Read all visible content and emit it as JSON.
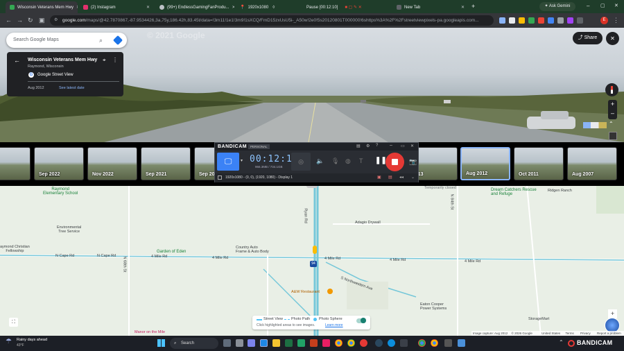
{
  "tabs": [
    {
      "title": "Wisconsin Veterans Mem Hwy",
      "color": "#34a853",
      "active": true
    },
    {
      "title": "(2) Instagram",
      "color": "#e1306c",
      "active": false
    },
    {
      "title": "(99+) EndlessGamingFanProdu...",
      "color": "#bdc1c6",
      "active": false
    },
    {
      "title": "1920x1080",
      "color": "#bdc1c6",
      "active": false
    },
    {
      "title": "Pause [00:12:10]",
      "color": "#bdc1c6",
      "active": false
    },
    {
      "title": "New Tab",
      "color": "#bdc1c6",
      "active": false
    }
  ],
  "browser": {
    "ask_gemini": "Ask Gemini",
    "url_host": "google.com",
    "url_path": "/maps/@42.7870867,-87.9534426,3a,75y,186.42h,83.45t/data=!3m11!1e1!3m9!1sXCQ/FmD15zxUsU5i-_A50w!2e0!5s20120801T000000!6shttps%3A%2F%2Fstreetviewpixels-pa.googleapis.com...",
    "profile_letter": "E"
  },
  "maps": {
    "search_placeholder": "Search Google Maps",
    "share_label": "Share",
    "watermark": "© 2021 Google",
    "place_title": "Wisconsin Veterans Mem Hwy",
    "place_subtitle": "Raymond, Wisconsin",
    "source_label": "Google Street View",
    "capture_date": "Aug 2012",
    "see_latest": "See latest date"
  },
  "filmstrip": [
    {
      "label": "",
      "selected": false
    },
    {
      "label": "Sep 2022",
      "selected": false
    },
    {
      "label": "Nov 2022",
      "selected": false
    },
    {
      "label": "Sep 2021",
      "selected": false
    },
    {
      "label": "Sep 20",
      "selected": false
    },
    {
      "label": "2013",
      "selected": false
    },
    {
      "label": "Aug 2012",
      "selected": true
    },
    {
      "label": "Oct 2011",
      "selected": false
    },
    {
      "label": "Aug 2007",
      "selected": false
    }
  ],
  "bandicam": {
    "brand": "BANDICAM",
    "edition": "PERSONAL",
    "timer": "00:12:10",
    "filesize": "966.3MB / 734.1GB",
    "resolution_info": "1920x1080 - (0, 0), (1920, 1080) - Display 1"
  },
  "map_labels": {
    "places": [
      {
        "text": "Raymond\nElementary School",
        "kind": "green"
      },
      {
        "text": "Environmental\nTree Service",
        "kind": "dark"
      },
      {
        "text": "aymond Christian\nFellowship",
        "kind": "dark"
      },
      {
        "text": "Garden of Eden",
        "kind": "green"
      },
      {
        "text": "Country Auto\nFrame & Auto Body",
        "kind": "dark"
      },
      {
        "text": "Adagio Drywall",
        "kind": "dark"
      },
      {
        "text": "A&W Restaurant",
        "kind": "orange"
      },
      {
        "text": "Eaton Cooper\nPower Systems",
        "kind": "dark"
      },
      {
        "text": "StorageMart",
        "kind": "dark"
      },
      {
        "text": "Manor on the Mile",
        "kind": "pink"
      },
      {
        "text": "Ridgen Ranch",
        "kind": "dark"
      },
      {
        "text": "Dream Catchers Rescue\nand Refuge",
        "kind": "green"
      },
      {
        "text": "Temporarily closed",
        "kind": "dark"
      }
    ],
    "roads": [
      "N Cape Rd",
      "N Cape Rd",
      "4 Mile Rd",
      "4 Mile Rd",
      "4 Mile Rd",
      "4 Mile Rd",
      "4 Mile Rd",
      "S Northwestern Ave",
      "N 68th St",
      "N 84th St",
      "Ryan Rd"
    ],
    "highway_shield": "94",
    "scale_badge": "100"
  },
  "legend": {
    "street_view": "Street View",
    "photo_path": "Photo Path",
    "photo_sphere": "Photo Sphere",
    "hint": "Click highlighted areas to see images.",
    "learn_more": "Learn more"
  },
  "map_footer": {
    "items": [
      "Image capture: Aug 2012",
      "© 2026 Google",
      "United States",
      "Terms",
      "Privacy",
      "Report a problem"
    ]
  },
  "taskbar": {
    "weather_line1": "Rainy days ahead",
    "weather_line2": "43°F",
    "search_label": "Search",
    "tray_brand": "BANDICAM"
  }
}
